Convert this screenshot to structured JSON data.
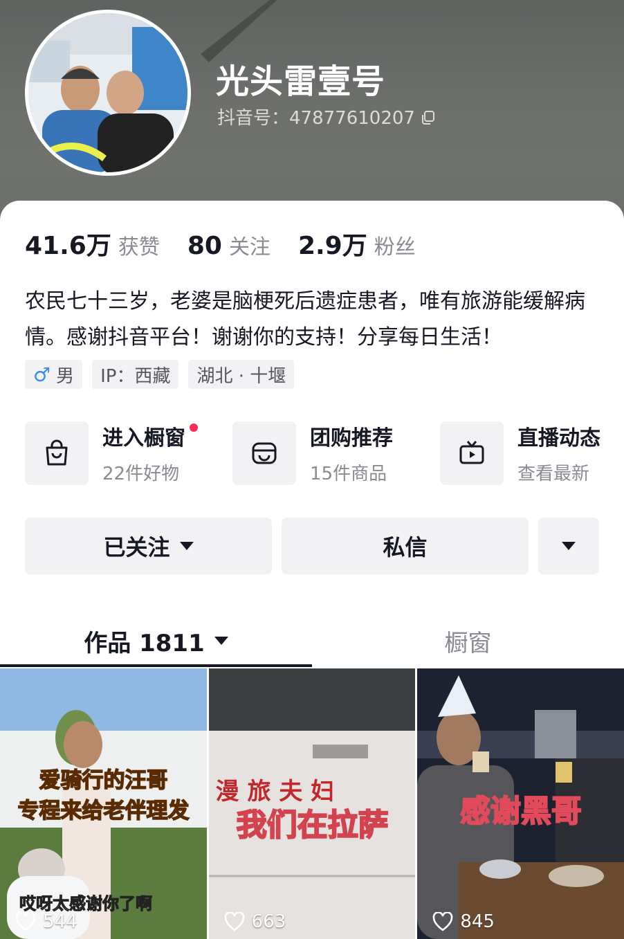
{
  "profile": {
    "nickname": "光头雷壹号",
    "douyin_id": "抖音号：47877610207"
  },
  "stats": [
    {
      "num": "41.6万",
      "label": "获赞"
    },
    {
      "num": "80",
      "label": "关注"
    },
    {
      "num": "2.9万",
      "label": "粉丝"
    }
  ],
  "bio": "农民七十三岁，老婆是脑梗死后遗症患者，唯有旅游能缓解病情。感谢抖音平台！谢谢你的支持！分享每日生活！",
  "tags": {
    "gender": "男",
    "ip": "IP：西藏",
    "location": "湖北 · 十堰"
  },
  "services": [
    {
      "title": "进入橱窗",
      "sub": "22件好物",
      "icon": "shopping-bag-icon"
    },
    {
      "title": "团购推荐",
      "sub": "15件商品",
      "icon": "group-buy-icon"
    },
    {
      "title": "直播动态",
      "sub": "查看最新",
      "icon": "live-tv-icon"
    }
  ],
  "actions": {
    "follow": "已关注",
    "message": "私信"
  },
  "tabs": {
    "works": "作品 1811",
    "shop": "橱窗"
  },
  "videos": [
    {
      "caption_1": "爱骑行的汪哥",
      "caption_2": "专程来给老伴理发",
      "subtitle": "哎呀太感谢你了啊",
      "likes": "544"
    },
    {
      "caption_1": "我们在拉萨",
      "caption_2": "漫 旅 夫 妇",
      "likes": "663"
    },
    {
      "caption_1": "感谢黑哥",
      "likes": "845"
    }
  ],
  "colors": {
    "accent_red": "#fe2c55",
    "text_primary": "#161823",
    "text_secondary": "#8a8b91",
    "button_bg": "#f2f2f4"
  }
}
